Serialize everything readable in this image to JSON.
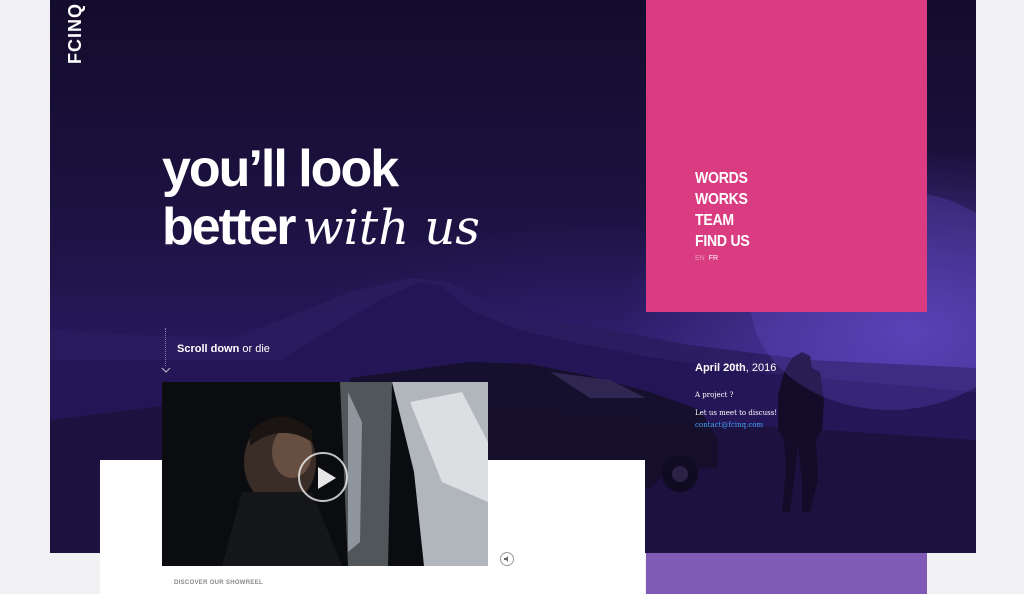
{
  "brand": {
    "logo_text": "FCINQ"
  },
  "hero": {
    "headline_line1": "you’ll look",
    "headline_line2_bold": "better",
    "headline_line2_script": "with us"
  },
  "scroll": {
    "bold": "Scroll down",
    "rest": " or die"
  },
  "menu": {
    "items": [
      "WORDS",
      "WORKS",
      "TEAM",
      "FIND US"
    ],
    "lang_en": "EN",
    "lang_fr": "FR"
  },
  "event": {
    "date_bold": "April 20th",
    "date_rest": ", 2016",
    "project_q": "A project ?",
    "meet": "Let us meet to discuss!",
    "contact": "contact@fcinq.com"
  },
  "video": {
    "showreel_label": "DISCOVER OUR SHOWREEL"
  },
  "colors": {
    "pink": "#d93c81",
    "dark_purple": "#1d1242",
    "light_purple": "#7f5bb5",
    "link_blue": "#4aa3ff"
  },
  "icons": {
    "play": "play-icon",
    "sound": "speaker-icon",
    "chevron": "chevron-down-icon"
  }
}
